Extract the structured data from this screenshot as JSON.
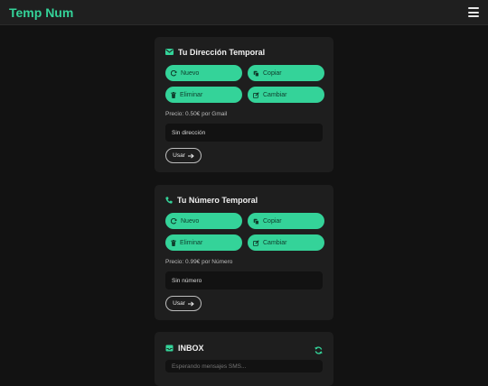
{
  "app": {
    "brand": "Temp Num"
  },
  "email_card": {
    "title": "Tu Dirección Temporal",
    "icon": "envelope-icon",
    "buttons": {
      "nuevo": "Nuevo",
      "copiar": "Copiar",
      "eliminar": "Eliminar",
      "cambiar": "Cambiar"
    },
    "price": "Precio: 0.50€ por Gmail",
    "value": "Sin dirección",
    "use_label": "Usar"
  },
  "phone_card": {
    "title": "Tu Número Temporal",
    "icon": "phone-icon",
    "buttons": {
      "nuevo": "Nuevo",
      "copiar": "Copiar",
      "eliminar": "Eliminar",
      "cambiar": "Cambiar"
    },
    "price": "Precio: 0.99€ por Número",
    "value": "Sin número",
    "use_label": "Usar"
  },
  "inbox": {
    "title": "INBOX",
    "icon": "inbox-icon",
    "refresh_icon": "refresh-icon",
    "placeholder": "Esperando mensajes SMS..."
  },
  "colors": {
    "accent": "#34d399",
    "background": "#121212",
    "card": "#1e1e1e",
    "topbar": "#1f1f1f"
  }
}
